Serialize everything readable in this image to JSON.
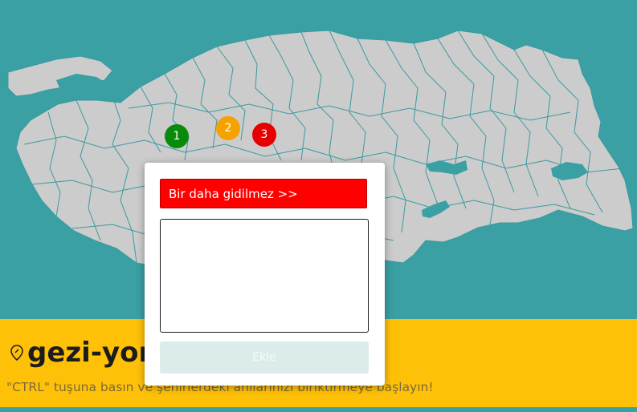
{
  "app": {
    "brand_name": "gezi-yor",
    "hint_text": "\"CTRL\" tuşuna basın ve şehirlerdeki anılarınızı biriktirmeye başlayın!"
  },
  "colors": {
    "sea": "#3aa0a4",
    "land": "#cccccc",
    "footer": "#ffc107",
    "marker_green": "#0a8a0a",
    "marker_orange": "#f5a200",
    "marker_red": "#e60000",
    "banner_red": "#ff0000"
  },
  "icons": {
    "brand": "map-pin-icon"
  },
  "markers": [
    {
      "label": "1",
      "color": "#0a8a0a"
    },
    {
      "label": "2",
      "color": "#f5a200"
    },
    {
      "label": "3",
      "color": "#e60000"
    }
  ],
  "modal": {
    "banner_text": "Bir daha gidilmez >>",
    "textarea_value": "",
    "submit_label": "Ekle"
  }
}
